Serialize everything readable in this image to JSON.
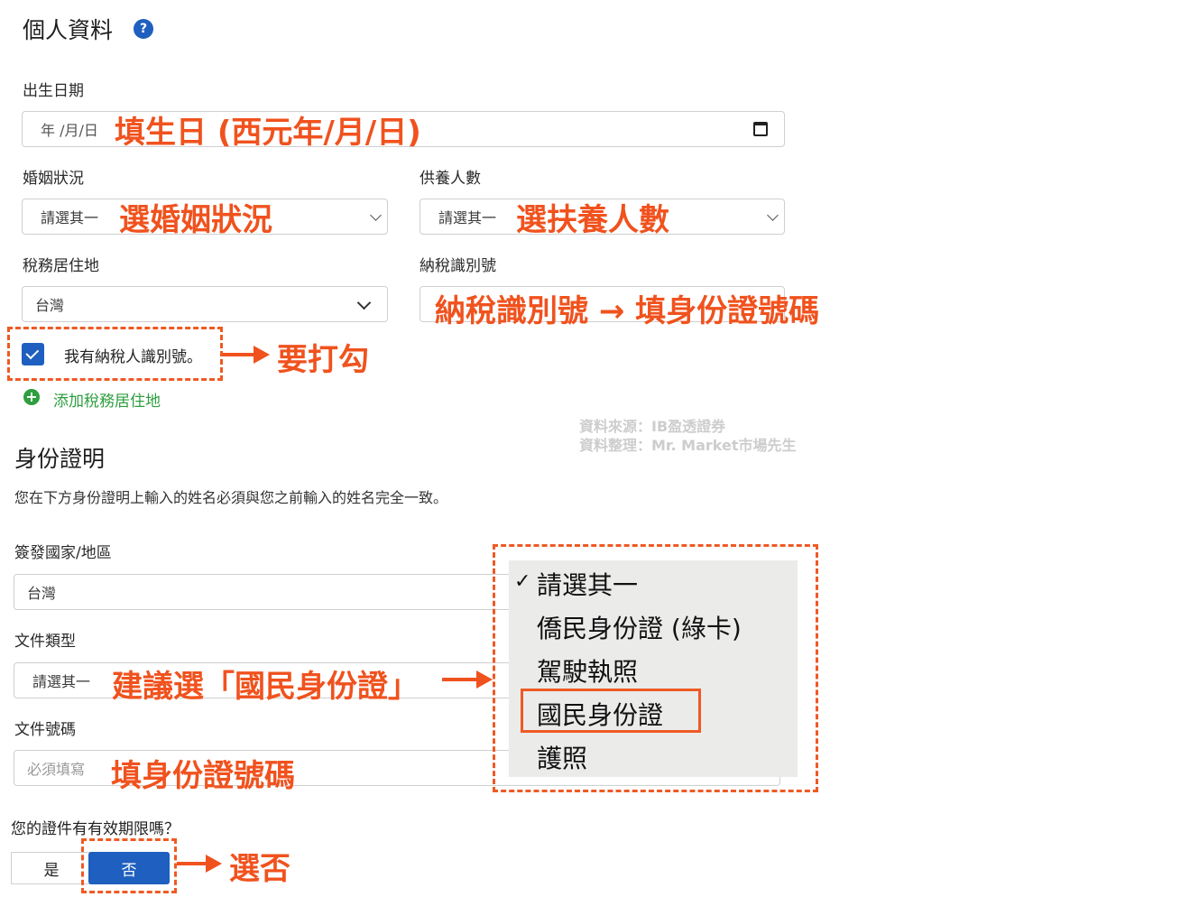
{
  "personal": {
    "title": "個人資料",
    "help_icon": "?",
    "birthdate": {
      "label": "出生日期",
      "placeholder": "年 /月/日",
      "annotation": "填生日 (西元年/月/日)"
    },
    "marital": {
      "label": "婚姻狀況",
      "value": "請選其一",
      "annotation": "選婚姻狀況"
    },
    "dependents": {
      "label": "供養人數",
      "value": "請選其一",
      "annotation": "選扶養人數"
    },
    "tax_residence": {
      "label": "稅務居住地",
      "value": "台灣"
    },
    "tax_id": {
      "label": "納稅識別號",
      "annotation": "納稅識別號 → 填身份證號碼"
    },
    "has_tax_id": {
      "label": "我有納稅人識別號。",
      "checked": true,
      "annotation": "要打勾"
    },
    "add_residence": "添加稅務居住地"
  },
  "watermark": {
    "line1": "資料來源：IB盈透證券",
    "line2": "資料整理：Mr. Market市場先生"
  },
  "identity": {
    "title": "身份證明",
    "description": "您在下方身份證明上輸入的姓名必須與您之前輸入的姓名完全一致。",
    "issuing_country": {
      "label": "簽發國家/地區",
      "value": "台灣"
    },
    "doc_type": {
      "label": "文件類型",
      "value": "請選其一",
      "annotation": "建議選「國民身份證」"
    },
    "doc_number": {
      "label": "文件號碼",
      "placeholder": "必須填寫",
      "annotation": "填身份證號碼"
    },
    "dropdown": {
      "checkmark": "✓",
      "options": [
        "請選其一",
        "僑民身份證 (綠卡)",
        "駕駛執照",
        "國民身份證",
        "護照"
      ],
      "selected_index": 0,
      "highlighted_index": 3
    },
    "expiry": {
      "question": "您的證件有有效期限嗎？",
      "yes_label": "是",
      "no_label": "否",
      "annotation": "選否"
    }
  },
  "colors": {
    "accent_blue": "#1f5fbf",
    "annotation_orange": "#f0521e",
    "add_green": "#2e9e3f"
  }
}
